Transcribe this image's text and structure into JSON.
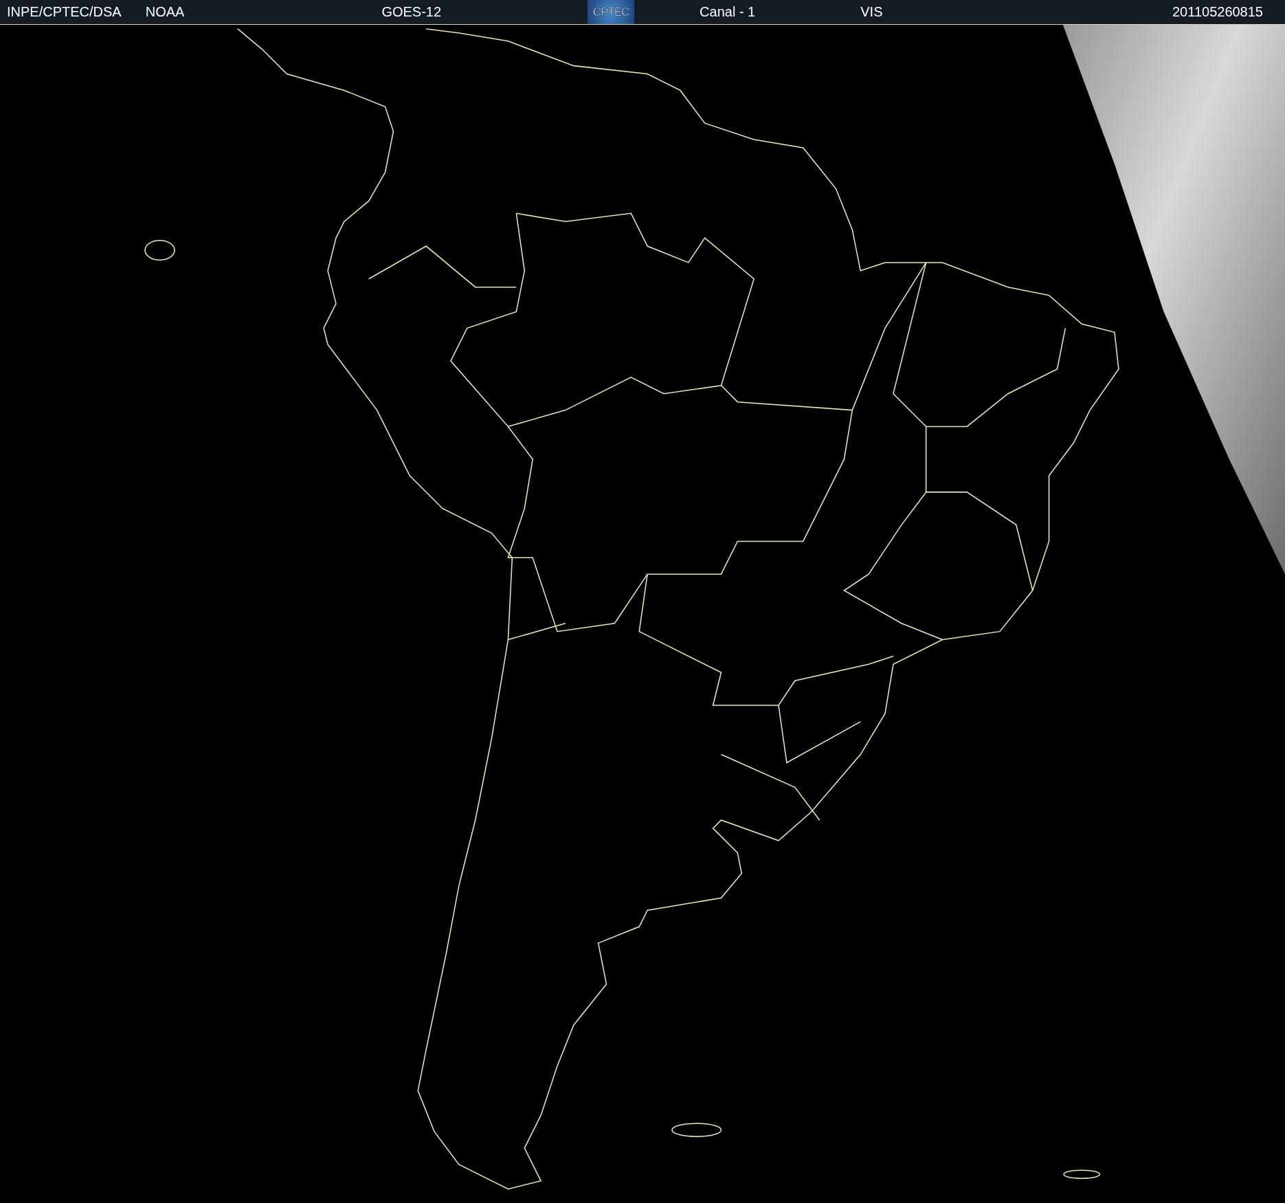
{
  "header": {
    "source": "INPE/CPTEC/DSA",
    "agency": "NOAA",
    "satellite": "GOES-12",
    "logo_text": "CPTEC",
    "channel": "Canal - 1",
    "band": "VIS",
    "timestamp": "201105260815"
  }
}
